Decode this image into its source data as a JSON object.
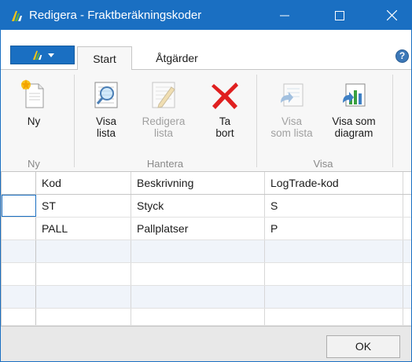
{
  "window": {
    "title": "Redigera - Fraktberäkningskoder",
    "accent_color": "#1a6fc2",
    "caption_buttons": [
      "minimize-icon",
      "maximize-icon",
      "close-icon"
    ]
  },
  "ribbon": {
    "tabs": [
      {
        "label": "Start",
        "active": true
      },
      {
        "label": "Åtgärder",
        "active": false
      }
    ],
    "groups": [
      {
        "label": "Ny",
        "buttons": [
          {
            "label": "Ny",
            "icon": "new-document-icon",
            "enabled": true
          }
        ]
      },
      {
        "label": "Hantera",
        "buttons": [
          {
            "label_line1": "Visa",
            "label_line2": "lista",
            "icon": "view-list-icon",
            "enabled": true
          },
          {
            "label_line1": "Redigera",
            "label_line2": "lista",
            "icon": "edit-list-icon",
            "enabled": false
          },
          {
            "label_line1": "Ta",
            "label_line2": "bort",
            "icon": "delete-icon",
            "enabled": true
          }
        ]
      },
      {
        "label": "Visa",
        "buttons": [
          {
            "label_line1": "Visa",
            "label_line2": "som lista",
            "icon": "show-as-list-icon",
            "enabled": false
          },
          {
            "label_line1": "Visa som",
            "label_line2": "diagram",
            "icon": "show-as-chart-icon",
            "enabled": true
          }
        ]
      }
    ]
  },
  "grid": {
    "columns": [
      "Kod",
      "Beskrivning",
      "LogTrade-kod"
    ],
    "rows": [
      {
        "kod": "ST",
        "beskrivning": "Styck",
        "logtrade": "S",
        "selected": true
      },
      {
        "kod": "PALL",
        "beskrivning": "Pallplatser",
        "logtrade": "P",
        "selected": false
      }
    ]
  },
  "footer": {
    "ok_label": "OK"
  }
}
